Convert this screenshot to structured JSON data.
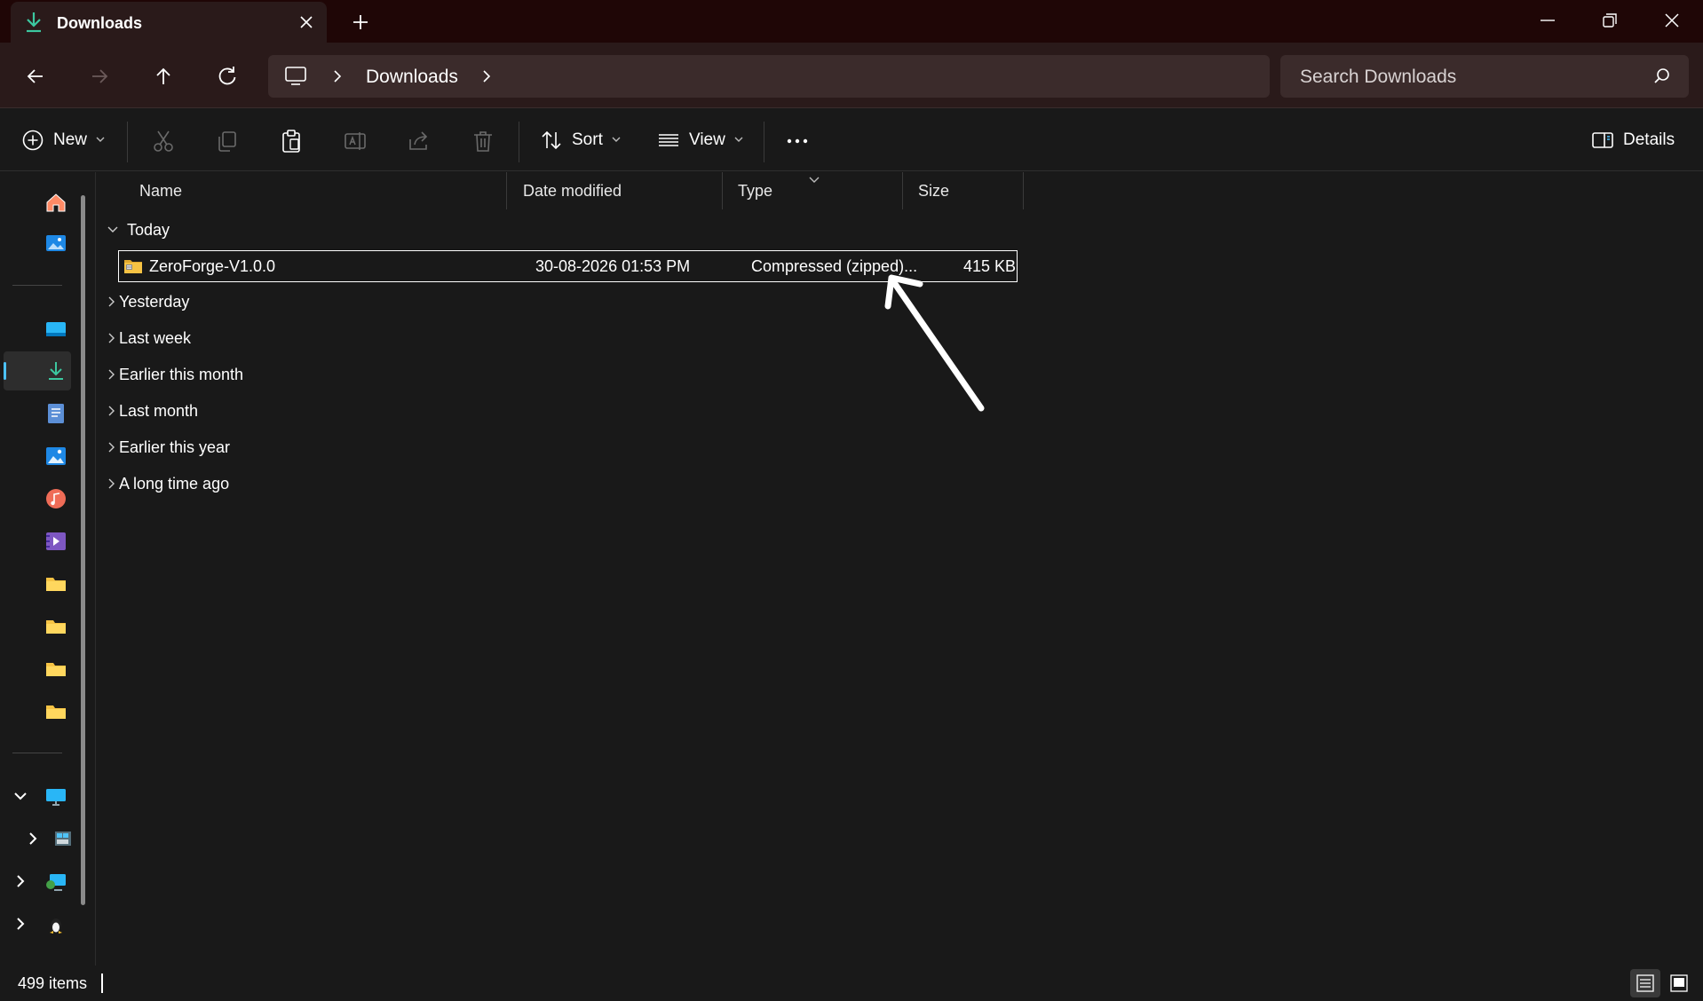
{
  "tab": {
    "title": "Downloads",
    "icon": "download-icon",
    "close_icon": "close-icon",
    "new_tab_icon": "plus-icon"
  },
  "window_controls": {
    "minimize_icon": "minimize-icon",
    "restore_icon": "restore-icon",
    "close_icon": "close-icon"
  },
  "nav": {
    "back_icon": "arrow-left-icon",
    "forward_icon": "arrow-right-icon",
    "up_icon": "arrow-up-icon",
    "refresh_icon": "refresh-icon",
    "breadcrumb": [
      "Downloads"
    ],
    "search_placeholder": "Search Downloads"
  },
  "toolbar": {
    "new_label": "New",
    "sort_label": "Sort",
    "view_label": "View",
    "details_label": "Details",
    "icons": [
      "cut-icon",
      "copy-icon",
      "paste-icon",
      "rename-icon",
      "share-icon",
      "delete-icon",
      "more-icon"
    ]
  },
  "columns": {
    "name": "Name",
    "date": "Date modified",
    "type": "Type",
    "size": "Size"
  },
  "groups": [
    {
      "label": "Today",
      "expanded": true
    },
    {
      "label": "Yesterday",
      "expanded": false
    },
    {
      "label": "Last week",
      "expanded": false
    },
    {
      "label": "Earlier this month",
      "expanded": false
    },
    {
      "label": "Last month",
      "expanded": false
    },
    {
      "label": "Earlier this year",
      "expanded": false
    },
    {
      "label": "A long time ago",
      "expanded": false
    }
  ],
  "files": [
    {
      "name": "ZeroForge-V1.0.0",
      "date": "30-08-2026 01:53 PM",
      "type": "Compressed (zipped)...",
      "size": "415 KB",
      "icon": "zip-folder-icon"
    }
  ],
  "sidebar": {
    "items": [
      "home-icon",
      "gallery-icon",
      "desktop-icon",
      "downloads-icon",
      "documents-icon",
      "pictures-icon",
      "music-icon",
      "videos-icon",
      "folder-icon",
      "folder-icon",
      "folder-icon",
      "folder-icon",
      "this-pc-icon",
      "drive-icon",
      "network-icon",
      "linux-icon"
    ],
    "active": "downloads-icon"
  },
  "status": {
    "item_count": "499 items"
  },
  "colors": {
    "accent": "#4cc2ff",
    "title_bar": "#1f0606",
    "nav_bar": "#2a1a1a",
    "folder": "#f6c344"
  }
}
